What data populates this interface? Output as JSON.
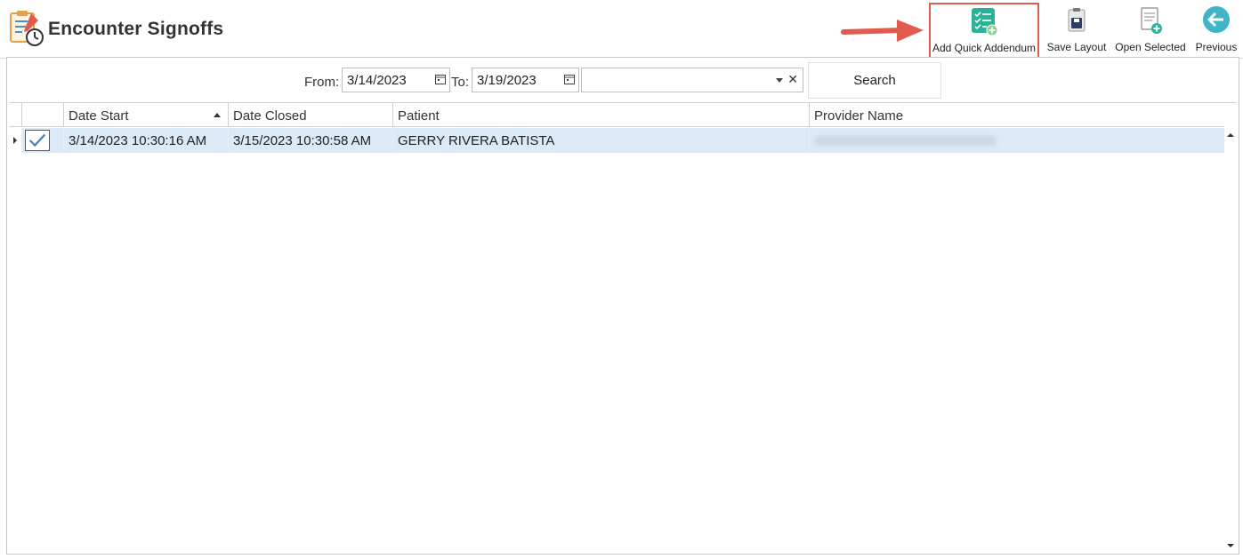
{
  "header": {
    "title": "Encounter Signoffs",
    "app_icon": "clipboard-clock-icon"
  },
  "toolbar": {
    "add_quick_addendum": {
      "label": "Add Quick Addendum",
      "icon": "checklist-add-icon",
      "highlighted": true
    },
    "save_layout": {
      "label": "Save Layout",
      "icon": "clipboard-save-icon"
    },
    "open_selected": {
      "label": "Open Selected",
      "icon": "document-add-icon"
    },
    "previous": {
      "label": "Previous",
      "icon": "arrow-left-circle-icon"
    }
  },
  "annotation": {
    "arrow_color": "#e05a4e",
    "icon": "arrow-right-icon"
  },
  "filter": {
    "from_label": "From:",
    "from_value": "3/14/2023",
    "to_label": "To:",
    "to_value": "3/19/2023",
    "combo_value": "",
    "clear_glyph": "✕",
    "search_label": "Search"
  },
  "grid": {
    "columns": [
      "Date Start",
      "Date Closed",
      "Patient",
      "Provider Name"
    ],
    "sorted_column": "Date Start",
    "sort_direction": "ascending",
    "rows": [
      {
        "checked": true,
        "date_start": "3/14/2023 10:30:16 AM",
        "date_closed": "3/15/2023 10:30:58 AM",
        "patient": "GERRY RIVERA BATISTA",
        "provider_name_redacted": true
      }
    ],
    "selected_row_color": "#dce9f7"
  },
  "colors": {
    "accent_teal": "#2bb39a",
    "highlight_red": "#e05a4e",
    "previous_teal": "#3fb6c8"
  }
}
